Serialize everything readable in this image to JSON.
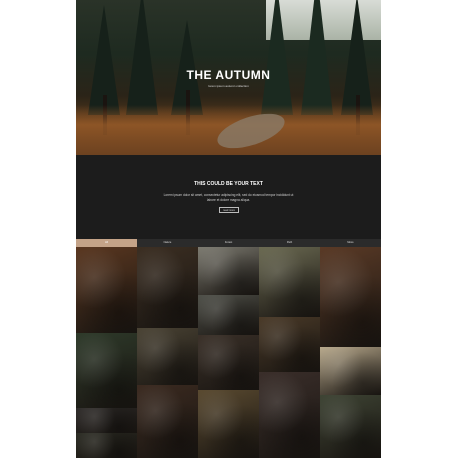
{
  "hero": {
    "title": "THE AUTUMN",
    "subtitle": "lorem ipsum autumn collection"
  },
  "intro": {
    "title": "THIS COULD BE YOUR TEXT",
    "body": "Lorem ipsum dolor sit amet, consectetur adipiscing elit, sed do eiusmod tempor incididunt ut labore et dolore magna aliqua.",
    "button_label": "read more"
  },
  "tabs": [
    {
      "label": "All",
      "active": true
    },
    {
      "label": "Nature",
      "active": false
    },
    {
      "label": "Forest",
      "active": false
    },
    {
      "label": "Path",
      "active": false
    },
    {
      "label": "Moss",
      "active": false
    }
  ],
  "gallery": {
    "tiles": [
      {
        "name": "photo-ferns-close",
        "color": "#5a3720"
      },
      {
        "name": "photo-dark-forest-ferns",
        "color": "#3b2e22"
      },
      {
        "name": "photo-misty-road",
        "color": "#7c7a70"
      },
      {
        "name": "photo-trees-lake",
        "color": "#6b6a52"
      },
      {
        "name": "photo-leaves-ground",
        "color": "#5a3a26"
      },
      {
        "name": "photo-tall-trunks",
        "color": "#2e3a2a"
      },
      {
        "name": "photo-forest-clearing",
        "color": "#4a4334"
      },
      {
        "name": "photo-foggy-path",
        "color": "#4e4f48"
      },
      {
        "name": "photo-dark-woods",
        "color": "#3a3028"
      },
      {
        "name": "photo-old-tree",
        "color": "#4a3a28"
      },
      {
        "name": "photo-building-leaves",
        "color": "#b8a98c"
      },
      {
        "name": "photo-forest-river",
        "color": "#5a4a30"
      },
      {
        "name": "photo-bracken",
        "color": "#3b2a20"
      },
      {
        "name": "photo-white-flowers",
        "color": "#3a2e2a"
      },
      {
        "name": "photo-moss-rock",
        "color": "#3e4434"
      },
      {
        "name": "photo-frosty-leaves",
        "color": "#2d2a28"
      },
      {
        "name": "photo-fern-fronds",
        "color": "#2a2a22"
      }
    ]
  }
}
